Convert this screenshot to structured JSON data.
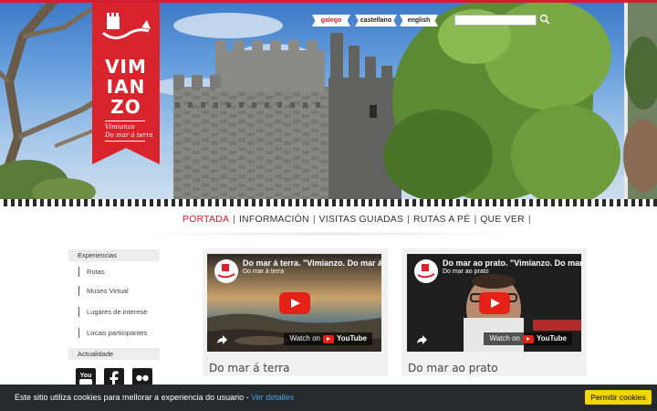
{
  "logo": {
    "line1": "VIM",
    "line2": "IAN",
    "line3": "ZO",
    "tagline1": "Vimianzo",
    "tagline2": "Do mar á terra"
  },
  "languages": [
    {
      "label": "galego",
      "active": true
    },
    {
      "label": "castellano",
      "active": false
    },
    {
      "label": "english",
      "active": false
    }
  ],
  "search": {
    "placeholder": "",
    "icon": "search-icon"
  },
  "nav": [
    {
      "label": "PORTADA",
      "active": true
    },
    {
      "label": "INFORMACIÓN",
      "active": false
    },
    {
      "label": "VISITAS GUIADAS",
      "active": false
    },
    {
      "label": "RUTAS A PÉ",
      "active": false
    },
    {
      "label": "QUE VER",
      "active": false
    }
  ],
  "sidebar": {
    "experiences_heading": "Experiencias",
    "items": [
      "Rutas",
      "Museo Virtual",
      "Lugares de interese",
      "Locais participantes"
    ],
    "news_heading": "Actualidade",
    "social": [
      "youtube-icon",
      "facebook-icon",
      "flickr-icon"
    ]
  },
  "videos": [
    {
      "title": "Do mar á terra. \"Vimianzo. Do mar á",
      "channel": "Do mar á terra",
      "watch": "Watch on",
      "brand": "YouTube",
      "caption": "Do mar á terra"
    },
    {
      "title": "Do mar ao prato. \"Vimianzo. Do mar á",
      "channel": "Do mar ao prato",
      "watch": "Watch on",
      "brand": "YouTube",
      "caption": "Do mar ao prato"
    }
  ],
  "cookie": {
    "text": "Este sitio utiliza cookies para mellorar a experiencia do usuario - ",
    "link": "Ver detalles",
    "button": "Permitir cookies"
  },
  "colors": {
    "accent": "#d0202e",
    "cookie_bg": "#262a2d",
    "cookie_button": "#f1d600",
    "link": "#4aa3e0"
  }
}
